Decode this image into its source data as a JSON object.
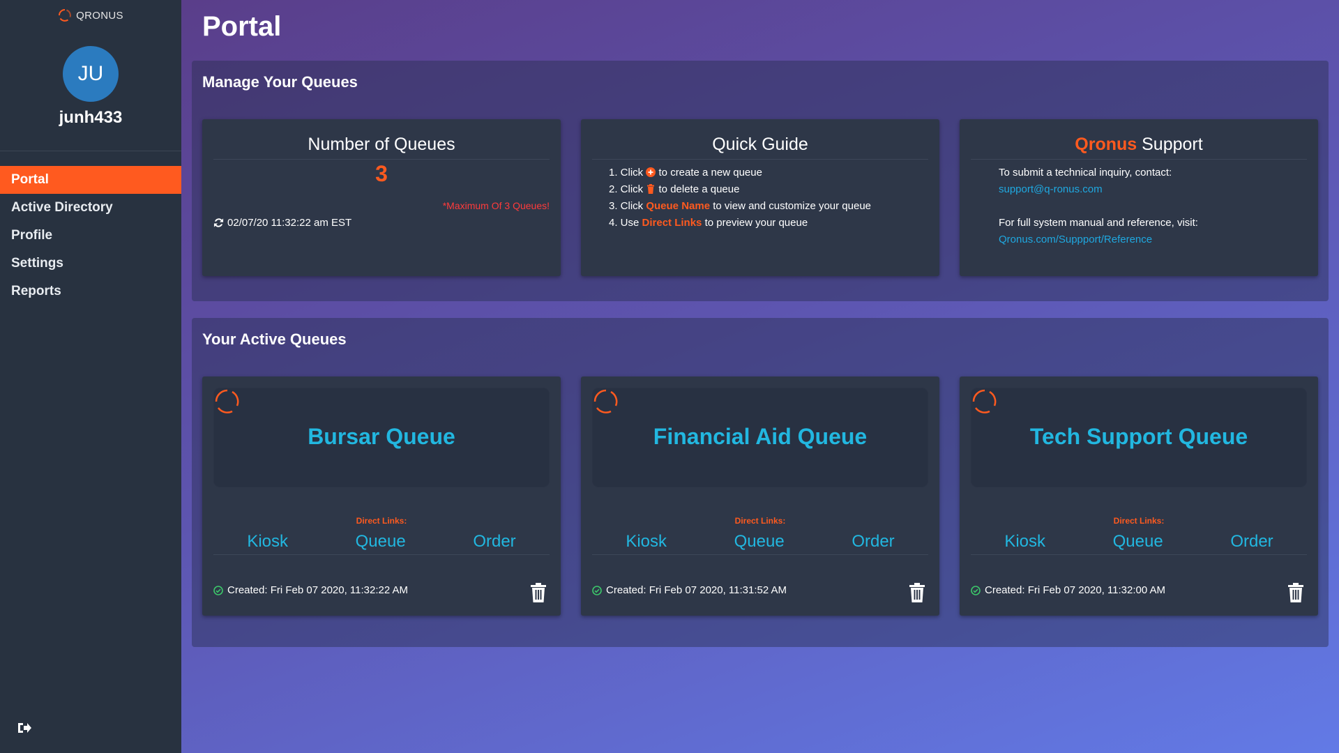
{
  "brand": {
    "name": "QRONUS"
  },
  "user": {
    "initials": "JU",
    "username": "junh433"
  },
  "nav": [
    {
      "label": "Portal",
      "active": true
    },
    {
      "label": "Active Directory",
      "active": false
    },
    {
      "label": "Profile",
      "active": false
    },
    {
      "label": "Settings",
      "active": false
    },
    {
      "label": "Reports",
      "active": false
    }
  ],
  "page": {
    "title": "Portal"
  },
  "manage": {
    "title": "Manage Your Queues",
    "count_card": {
      "title": "Number of Queues",
      "count": "3",
      "max_note": "*Maximum Of 3 Queues!",
      "timestamp": "02/07/20 11:32:22 am EST"
    },
    "guide": {
      "title": "Quick Guide",
      "step1_pre": "1. Click ",
      "step1_post": " to create a new queue",
      "step2_pre": "2. Click ",
      "step2_post": " to delete a queue",
      "step3_pre": "3. Click ",
      "step3_hl": "Queue Name",
      "step3_post": " to view and customize your queue",
      "step4_pre": "4. Use ",
      "step4_hl": "Direct Links",
      "step4_post": " to preview your queue"
    },
    "support": {
      "title_brand": "Qronus",
      "title_rest": " Support",
      "line1": "To submit a technical inquiry, contact:",
      "email": "support@q-ronus.com",
      "line2": "For full system manual and reference, visit:",
      "url": "Qronus.com/Suppport/Reference"
    }
  },
  "active": {
    "title": "Your Active Queues",
    "direct_links_label": "Direct Links:",
    "links": {
      "kiosk": "Kiosk",
      "queue": "Queue",
      "order": "Order"
    },
    "queues": [
      {
        "name": "Bursar Queue",
        "created": "Created: Fri Feb 07 2020, 11:32:22 AM"
      },
      {
        "name": "Financial Aid Queue",
        "created": "Created: Fri Feb 07 2020, 11:31:52 AM"
      },
      {
        "name": "Tech Support Queue",
        "created": "Created: Fri Feb 07 2020, 11:32:00 AM"
      }
    ]
  },
  "colors": {
    "accent": "#ff5a1f",
    "link": "#22b7e0",
    "sidebar": "#283240",
    "card": "#2e3748",
    "success": "#3cc76a"
  },
  "icons": {
    "brand": "spinner-icon",
    "refresh": "refresh-icon",
    "add": "plus-circle-icon",
    "delete": "trash-icon",
    "check": "check-circle-icon",
    "logout": "logout-icon"
  }
}
